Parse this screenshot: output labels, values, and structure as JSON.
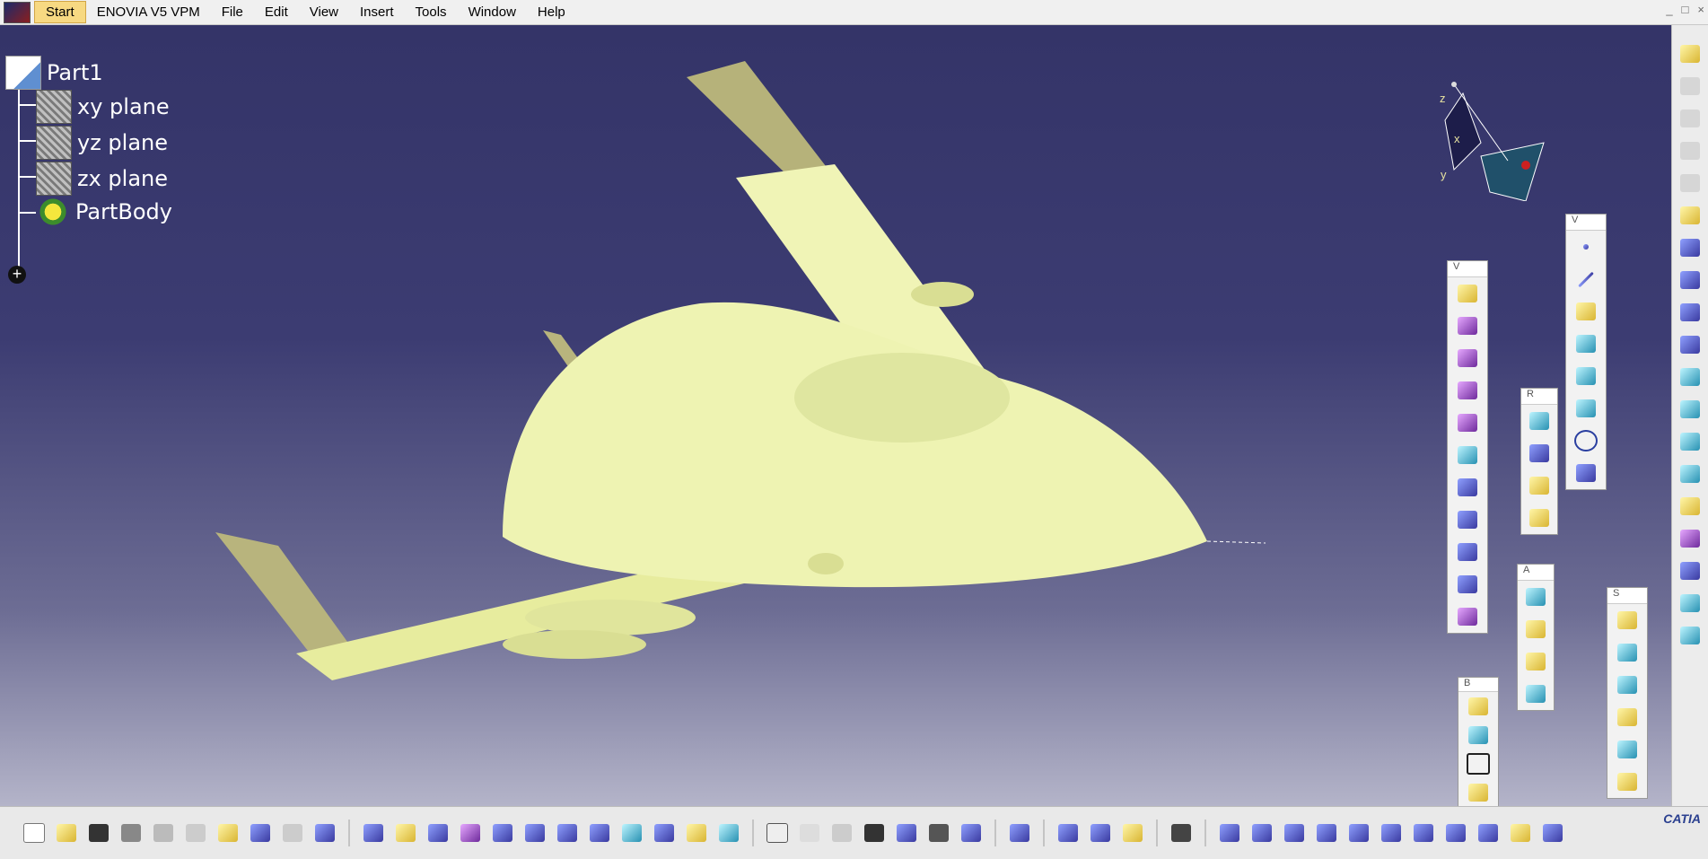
{
  "menubar": {
    "start": "Start",
    "app_title": "ENOVIA V5 VPM",
    "items": [
      "File",
      "Edit",
      "View",
      "Insert",
      "Tools",
      "Window",
      "Help"
    ]
  },
  "tree": {
    "root": "Part1",
    "planes": [
      "xy plane",
      "yz plane",
      "zx plane"
    ],
    "body": "PartBody",
    "expander": "+"
  },
  "compass": {
    "z": "z",
    "x": "x",
    "y": "y"
  },
  "floating_toolbars": [
    {
      "title": "V",
      "count": 11
    },
    {
      "title": "R",
      "count": 4
    },
    {
      "title": "V",
      "count": 8
    },
    {
      "title": "A",
      "count": 4
    },
    {
      "title": "S",
      "count": 6
    },
    {
      "title": "B",
      "count": 4
    }
  ],
  "window_controls": [
    "_",
    "□",
    "×"
  ],
  "brand": "CATIA",
  "colors": {
    "background_top": "#343468",
    "background_bottom": "#b4b4c9",
    "model": "#f0f4b6"
  }
}
